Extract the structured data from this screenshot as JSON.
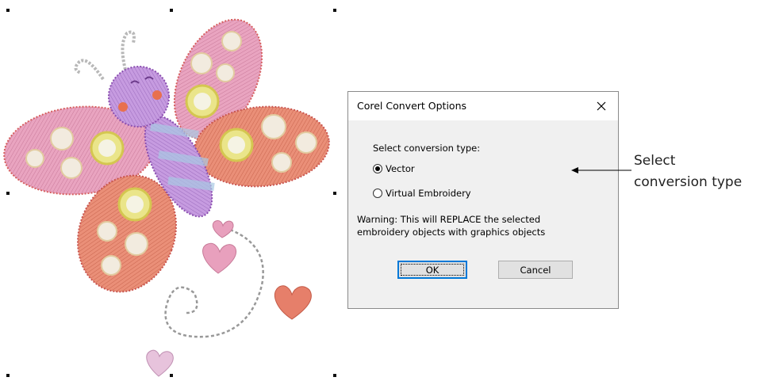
{
  "dialog": {
    "title": "Corel Convert Options",
    "close_icon": "close-icon",
    "prompt": "Select conversion type:",
    "options": [
      {
        "label": "Vector",
        "selected": true
      },
      {
        "label": "Virtual Embroidery",
        "selected": false
      }
    ],
    "warning_line1": "Warning: This will REPLACE the selected",
    "warning_line2": "embroidery objects with graphics objects",
    "ok_label": "OK",
    "cancel_label": "Cancel"
  },
  "callout": {
    "line1": "Select",
    "line2": "conversion type"
  },
  "artwork": {
    "subject": "embroidered-butterfly-with-hearts",
    "colors": {
      "pink": "#e79ab7",
      "coral": "#e8876f",
      "purple": "#b98bd6",
      "yellow": "#e8e07a"
    }
  }
}
